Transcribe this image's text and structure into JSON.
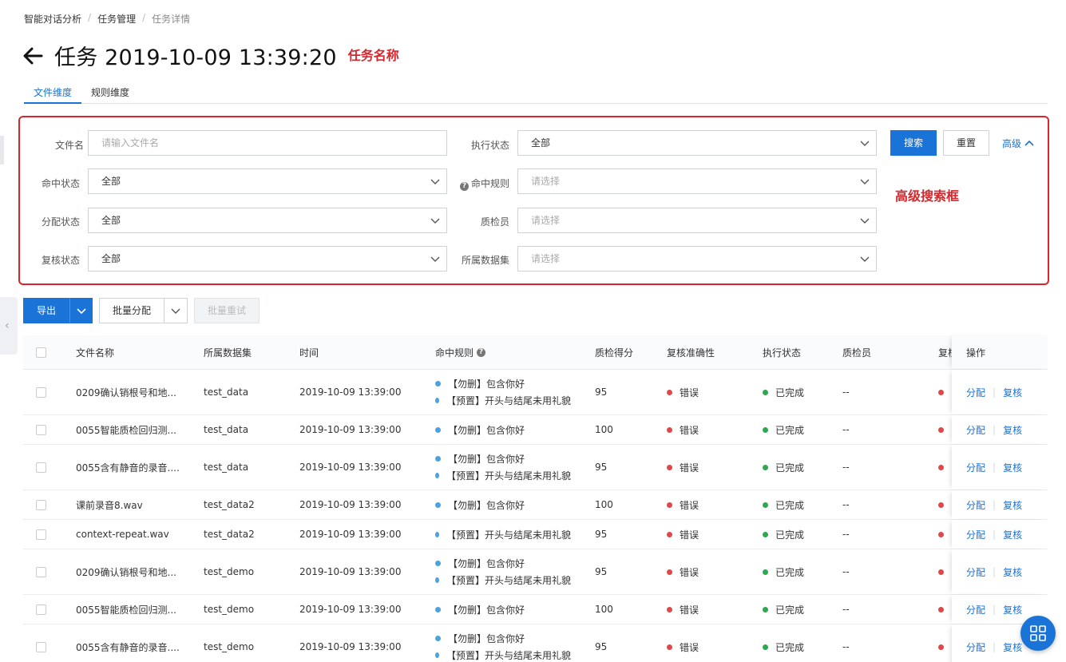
{
  "breadcrumb": [
    "智能对话分析",
    "任务管理",
    "任务详情"
  ],
  "breadcrumb_sep": "/",
  "page_title": "任务 2019-10-09 13:39:20",
  "annotation_title": "任务名称",
  "annotation_search": "高级搜索框",
  "tabs": [
    {
      "label": "文件维度",
      "active": true
    },
    {
      "label": "规则维度",
      "active": false
    }
  ],
  "search": {
    "file_name_label": "文件名",
    "file_name_placeholder": "请输入文件名",
    "exec_status_label": "执行状态",
    "exec_status_value": "全部",
    "hit_status_label": "命中状态",
    "hit_status_value": "全部",
    "hit_rule_label": "命中规则",
    "hit_rule_placeholder": "请选择",
    "assign_status_label": "分配状态",
    "assign_status_value": "全部",
    "inspector_label": "质检员",
    "inspector_placeholder": "请选择",
    "review_status_label": "复核状态",
    "review_status_value": "全部",
    "dataset_label": "所属数据集",
    "dataset_placeholder": "请选择",
    "search_button": "搜索",
    "reset_button": "重置",
    "advanced_label": "高级"
  },
  "toolbar": {
    "export_label": "导出",
    "batch_assign_label": "批量分配",
    "batch_retry_label": "批量重试"
  },
  "table": {
    "headers": {
      "file_name": "文件名称",
      "dataset": "所属数据集",
      "time": "时间",
      "hit_rules": "命中规则",
      "score": "质检得分",
      "review_accuracy": "复核准确性",
      "exec_status": "执行状态",
      "inspector": "质检员",
      "review_truncated": "复核",
      "actions": "操作"
    },
    "rows": [
      {
        "file": "0209确认销根号和地...",
        "dataset": "test_data",
        "time": "2019-10-09 13:39:00",
        "rules": [
          "【勿删】包含你好",
          "【预置】开头与结尾未用礼貌"
        ],
        "score": "95",
        "accuracy": "错误",
        "exec": "已完成",
        "inspector": "--"
      },
      {
        "file": "0055智能质检回归测...",
        "dataset": "test_data",
        "time": "2019-10-09 13:39:00",
        "rules": [
          "【勿删】包含你好"
        ],
        "score": "100",
        "accuracy": "错误",
        "exec": "已完成",
        "inspector": "--"
      },
      {
        "file": "0055含有静音的录音....",
        "dataset": "test_data",
        "time": "2019-10-09 13:39:00",
        "rules": [
          "【勿删】包含你好",
          "【预置】开头与结尾未用礼貌"
        ],
        "score": "95",
        "accuracy": "错误",
        "exec": "已完成",
        "inspector": "--"
      },
      {
        "file": "课前录音8.wav",
        "dataset": "test_data2",
        "time": "2019-10-09 13:39:00",
        "rules": [
          "【勿删】包含你好"
        ],
        "score": "100",
        "accuracy": "错误",
        "exec": "已完成",
        "inspector": "--"
      },
      {
        "file": "context-repeat.wav",
        "dataset": "test_data2",
        "time": "2019-10-09 13:39:00",
        "rules": [
          "【预置】开头与结尾未用礼貌"
        ],
        "score": "95",
        "accuracy": "错误",
        "exec": "已完成",
        "inspector": "--"
      },
      {
        "file": "0209确认销根号和地...",
        "dataset": "test_demo",
        "time": "2019-10-09 13:39:00",
        "rules": [
          "【勿删】包含你好",
          "【预置】开头与结尾未用礼貌"
        ],
        "score": "95",
        "accuracy": "错误",
        "exec": "已完成",
        "inspector": "--"
      },
      {
        "file": "0055智能质检回归测...",
        "dataset": "test_demo",
        "time": "2019-10-09 13:39:00",
        "rules": [
          "【勿删】包含你好"
        ],
        "score": "100",
        "accuracy": "错误",
        "exec": "已完成",
        "inspector": "--"
      },
      {
        "file": "0055含有静音的录音....",
        "dataset": "test_demo",
        "time": "2019-10-09 13:39:00",
        "rules": [
          "【勿删】包含你好",
          "【预置】开头与结尾未用礼貌"
        ],
        "score": "95",
        "accuracy": "错误",
        "exec": "已完成",
        "inspector": "--"
      }
    ],
    "action_assign": "分配",
    "action_review": "复核",
    "action_sep": "|"
  },
  "colors": {
    "accent": "#1a73d6",
    "annotation": "#d9252b",
    "status_error": "#e04848",
    "status_done": "#2ea84f",
    "rule_dot": "#4aa3df"
  },
  "icons": {
    "back": "arrow-left-icon",
    "chevron": "chevron-down-icon",
    "help": "question-circle-icon",
    "float": "grid-apps-icon"
  }
}
